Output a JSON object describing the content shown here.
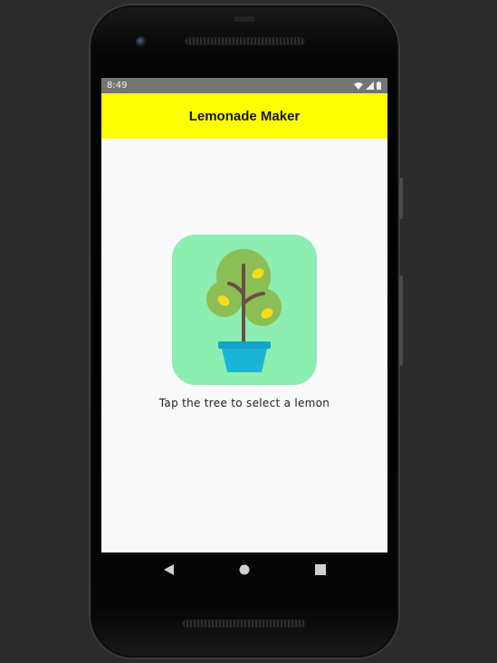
{
  "status_bar": {
    "time": "8:49",
    "icons": [
      "wifi-icon",
      "cellular-signal-icon",
      "battery-icon"
    ]
  },
  "app_bar": {
    "title": "Lemonade Maker",
    "background_color": "#ffff00"
  },
  "main": {
    "image_description_icon": "lemon-tree-icon",
    "image_background_color": "#8ceeb0",
    "instruction_text": "Tap the tree to select a lemon"
  },
  "nav_bar": {
    "buttons": [
      "back-icon",
      "home-icon",
      "recents-icon"
    ]
  }
}
